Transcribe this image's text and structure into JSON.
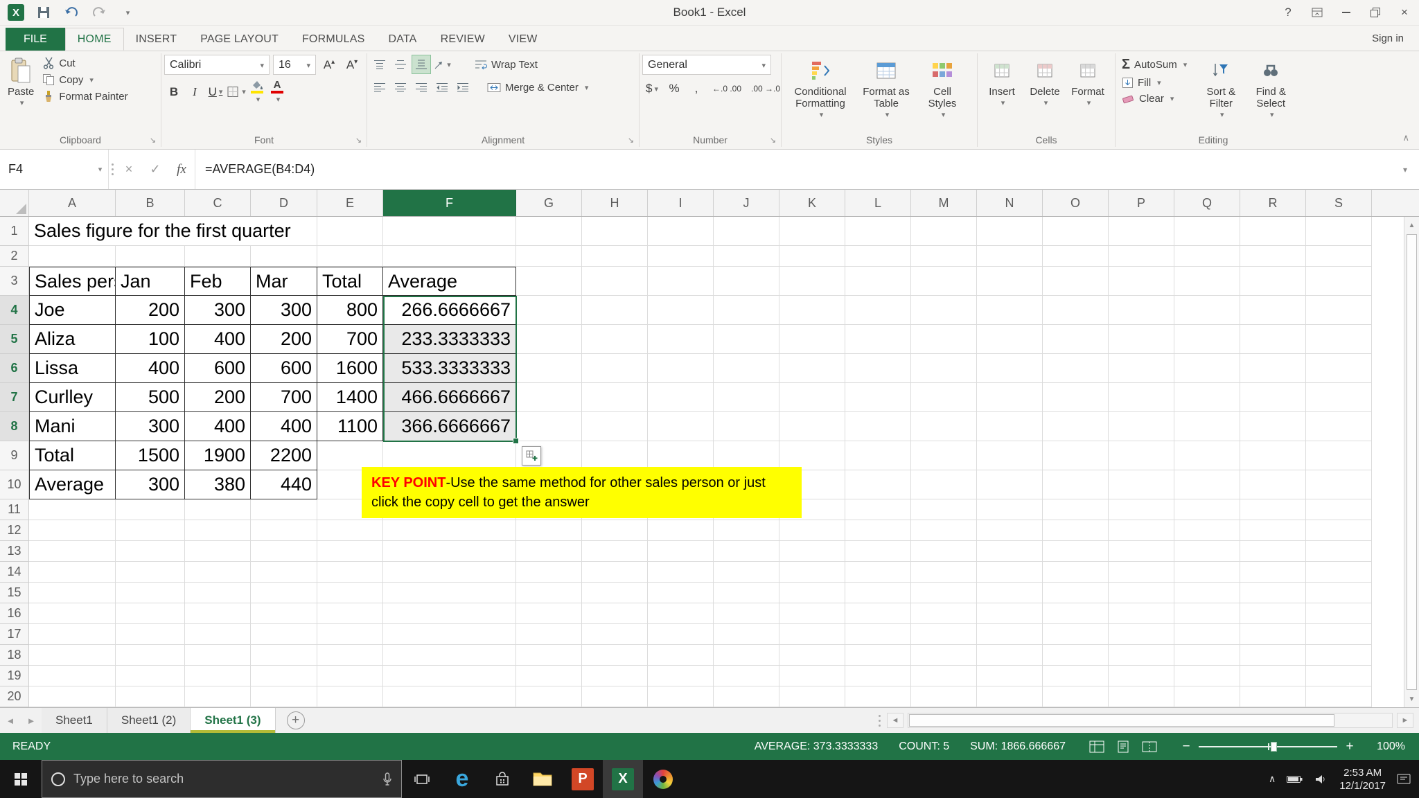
{
  "app": {
    "title": "Book1 - Excel",
    "sign_in": "Sign in",
    "help": "?"
  },
  "tabs": {
    "file": "FILE",
    "items": [
      "HOME",
      "INSERT",
      "PAGE LAYOUT",
      "FORM­ULAS",
      "DATA",
      "REVIEW",
      "VIEW"
    ],
    "active": "HOME"
  },
  "ribbon": {
    "clipboard": {
      "group": "Clipboard",
      "paste": "Paste",
      "cut": "Cut",
      "copy": "Copy",
      "format_painter": "Format Painter"
    },
    "font": {
      "group": "Font",
      "family": "Calibri",
      "size": "16",
      "bold": "B",
      "italic": "I",
      "underline": "U"
    },
    "alignment": {
      "group": "Alignment",
      "wrap_text": "Wrap Text",
      "merge_center": "Merge & Center"
    },
    "number": {
      "group": "Number",
      "format": "General",
      "currency": "$",
      "percent": "%",
      "comma": ","
    },
    "styles": {
      "group": "Styles",
      "conditional_formatting": "Conditional Formatting",
      "format_as_table": "Format as Table",
      "cell_styles": "Cell Styles"
    },
    "cells": {
      "group": "Cells",
      "insert": "Insert",
      "delete": "Delete",
      "format": "Format"
    },
    "editing": {
      "group": "Editing",
      "autosum": "AutoSum",
      "fill": "Fill",
      "clear": "Clear",
      "sort_filter": "Sort & Filter",
      "find_select": "Find & Select"
    }
  },
  "formula_bar": {
    "name_box": "F4",
    "fx": "fx",
    "formula": "=AVERAGE(B4:D4)"
  },
  "sheet": {
    "columns": [
      "A",
      "B",
      "C",
      "D",
      "E",
      "F",
      "G",
      "H",
      "I",
      "J",
      "K",
      "L",
      "M",
      "N",
      "O",
      "P",
      "Q",
      "R",
      "S"
    ],
    "rows": 20,
    "selected_column": "F",
    "selected_rows": [
      4,
      5,
      6,
      7,
      8
    ],
    "selected_range": "F4:F8",
    "a1_title": "Sales figure for the first quarter",
    "table_headers": [
      "Sales pers",
      "Jan",
      "Feb",
      "Mar",
      "Total",
      "Average"
    ],
    "table_rows": [
      [
        "Joe",
        "200",
        "300",
        "300",
        "800",
        "266.6666667"
      ],
      [
        "Aliza",
        "100",
        "400",
        "200",
        "700",
        "233.3333333"
      ],
      [
        "Lissa",
        "400",
        "600",
        "600",
        "1600",
        "533.3333333"
      ],
      [
        "Curlley",
        "500",
        "200",
        "700",
        "1400",
        "466.6666667"
      ],
      [
        "Mani",
        "300",
        "400",
        "400",
        "1100",
        "366.6666667"
      ],
      [
        "Total",
        "1500",
        "1900",
        "2200",
        "",
        ""
      ],
      [
        "Average",
        "300",
        "380",
        "440",
        "",
        ""
      ]
    ],
    "note_highlight": "KEY POINT",
    "note_text": "-Use the same method for other sales person or just click the copy cell to get the answer"
  },
  "sheet_bar": {
    "tabs": [
      "Sheet1",
      "Sheet1 (2)",
      "Sheet1 (3)"
    ],
    "active": "Sheet1 (3)"
  },
  "status_bar": {
    "mode": "READY",
    "average": "AVERAGE: 373.3333333",
    "count": "COUNT: 5",
    "sum": "SUM: 1866.666667",
    "zoom": "100%"
  },
  "taskbar": {
    "search_placeholder": "Type here to search",
    "time": "2:53 AM",
    "date": "12/1/2017"
  },
  "icons": {
    "dropdown": "▾",
    "sigma": "Σ",
    "cancel": "×",
    "enter": "✓",
    "up": "▲",
    "down": "▼",
    "left": "◄",
    "right": "►",
    "collapse": "∧",
    "tray_expand": "∧"
  },
  "colors": {
    "excel_green": "#217346",
    "tab_color": "#b3bb37",
    "note_yellow": "#ffff00",
    "note_red": "#ff0000"
  }
}
